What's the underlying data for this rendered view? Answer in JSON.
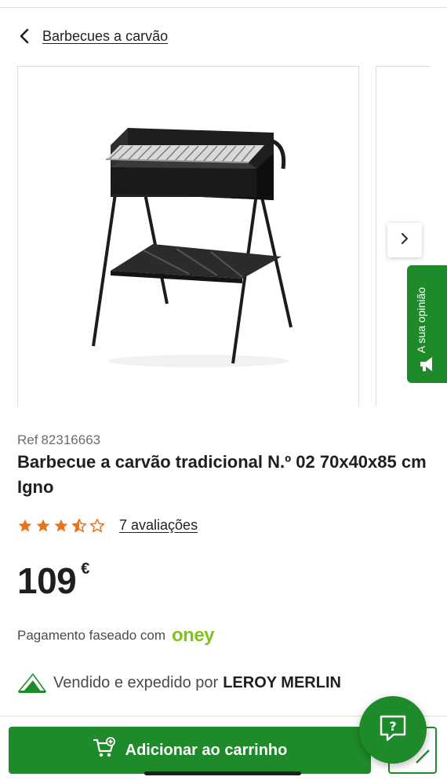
{
  "nav": {
    "back_label": "Barbecues a carvão"
  },
  "feedback_tab": {
    "label": "A sua opinião"
  },
  "product": {
    "ref_label": "Ref",
    "ref_number": "82316663",
    "title": "Barbecue a carvão tradicional N.º 02 70x40x85 cm Igno",
    "rating": 3.5,
    "rating_max": 5,
    "reviews_label": "7 avaliações",
    "price_integer": "109",
    "price_currency": "€",
    "installments_label": "Pagamento faseado com",
    "installments_partner": "oney",
    "seller_prefix": "Vendido e expedido por",
    "seller_name": "LEROY MERLIN"
  },
  "actions": {
    "add_to_cart_label": "Adicionar ao carrinho"
  },
  "colors": {
    "brand_green": "#1f8a2a",
    "star_orange": "#e8731a",
    "oney_green": "#7fc31c"
  },
  "icons": {
    "back": "chevron-left-icon",
    "next": "chevron-right-icon",
    "feedback": "megaphone-icon",
    "cart": "cart-plus-icon",
    "help": "help-chat-icon",
    "edit": "edit-icon"
  }
}
